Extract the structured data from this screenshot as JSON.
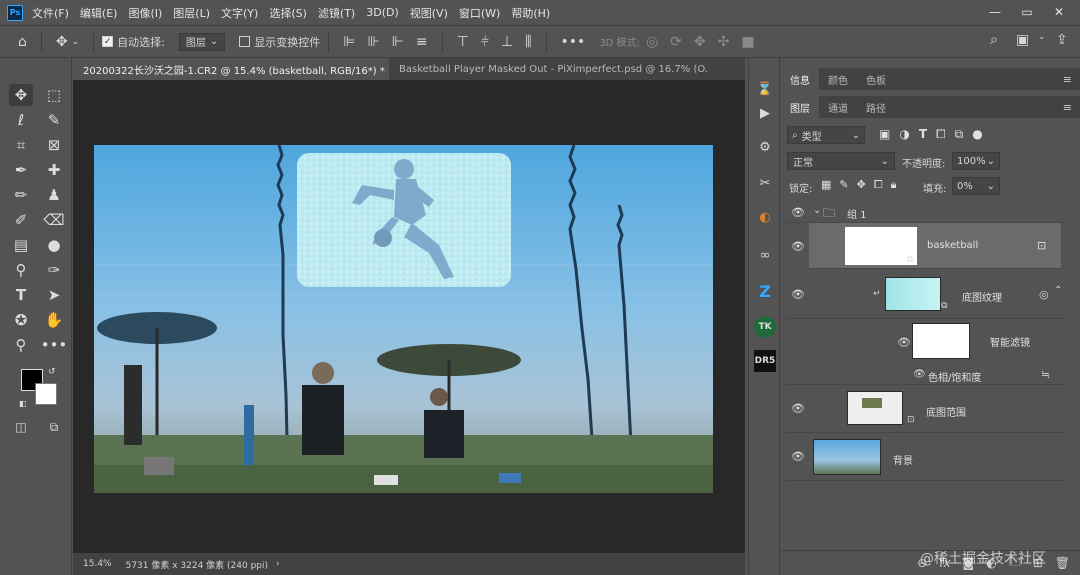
{
  "app": {
    "logo_text": "Ps"
  },
  "menu": [
    "文件(F)",
    "编辑(E)",
    "图像(I)",
    "图层(L)",
    "文字(Y)",
    "选择(S)",
    "滤镜(T)",
    "3D(D)",
    "视图(V)",
    "窗口(W)",
    "帮助(H)"
  ],
  "window_controls": {
    "minimize": "—",
    "maximize": "▭",
    "close": "✕"
  },
  "options": {
    "auto_select_label": "自动选择:",
    "auto_select_value": "图层",
    "show_transform_label": "显示变换控件",
    "mode_3d_label": "3D 模式:"
  },
  "tabs": [
    {
      "label": "20200322长沙沃之园-1.CR2 @ 15.4% (basketball, RGB/16*) *",
      "close": "×"
    },
    {
      "label": "Basketball Player Masked Out - PiXimperfect.psd @ 16.7% (O...",
      "close": "×"
    }
  ],
  "status": {
    "zoom": "15.4%",
    "doc_info": "5731 像素 x 3224 像素 (240 ppi)",
    "arrow": "›"
  },
  "panel_top": {
    "tabs": [
      "信息",
      "颜色",
      "色板"
    ]
  },
  "panel_layers": {
    "tabs": [
      "图层",
      "通道",
      "路径"
    ],
    "filter_kind": "类型",
    "blend_mode": "正常",
    "opacity_label": "不透明度:",
    "opacity_value": "100%",
    "lock_label": "锁定:",
    "fill_label": "填充:",
    "fill_value": "0%"
  },
  "layers": {
    "group": "组 1",
    "basketball": "basketball",
    "texture": "底图纹理",
    "smart_filter": "智能滤镜",
    "hue_sat": "色相/饱和度",
    "range": "底图范围",
    "background": "背景"
  },
  "bottom_bar": {
    "link": "⊖",
    "fx": "fx"
  },
  "watermark": "@稀土掘金技术社区",
  "colors": {
    "foreground": "#000000",
    "background": "#ffffff",
    "accent": "#31a8ff"
  }
}
